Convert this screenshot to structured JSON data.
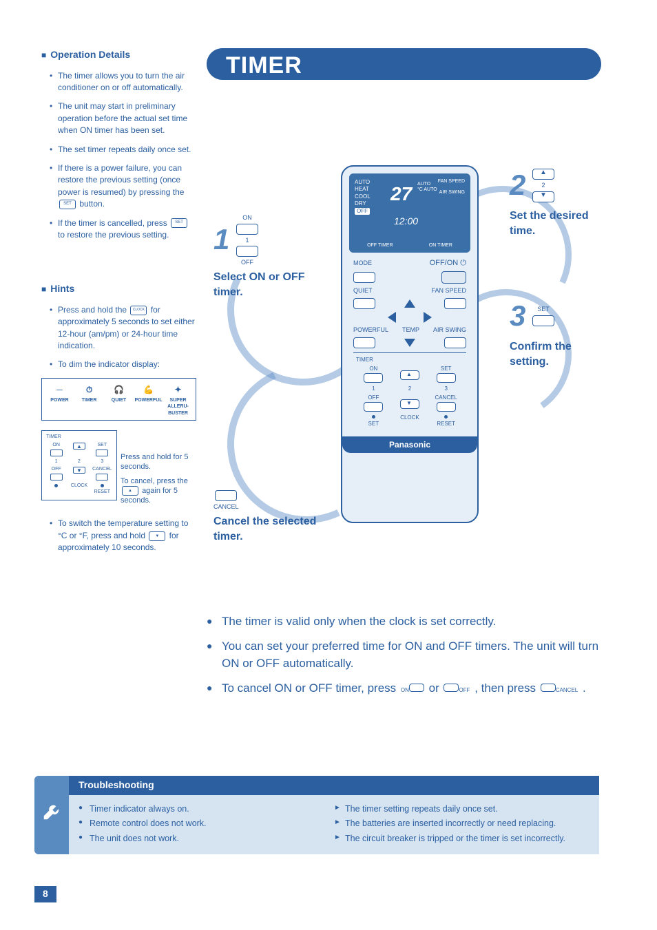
{
  "title": "TIMER",
  "page_number": "8",
  "left": {
    "op_details_head": "Operation Details",
    "op_details": [
      "The timer allows you to turn the air conditioner on or off automatically.",
      "The unit may start in preliminary operation before the actual set time when ON timer has been set.",
      "The set timer repeats daily once set.",
      "If there is a power failure, you can restore the previous setting (once power is resumed) by pressing the",
      "If the timer is cancelled, press"
    ],
    "op_btn_set": "SET",
    "op_prev_tail": " to restore the previous setting.",
    "op_four_tail": " button.",
    "hints_head": "Hints",
    "hints1_a": "Press and hold the ",
    "hints1_clock": "CLOCK",
    "hints1_b": " for approximately 5 seconds to set either 12-hour (am/pm) or 24-hour time indication.",
    "hints2": "To dim the indicator display:",
    "indicator": {
      "power": "POWER",
      "timer": "TIMER",
      "quiet": "QUIET",
      "powerful": "POWERFUL",
      "super": "SUPER ALLERU-BUSTER"
    },
    "mini_labels": {
      "timer": "TIMER",
      "on": "ON",
      "set": "SET",
      "one": "1",
      "two": "2",
      "three": "3",
      "off": "OFF",
      "cancel": "CANCEL",
      "clock": "CLOCK",
      "reset": "RESET"
    },
    "side_a": "Press and hold for 5 seconds.",
    "side_b": "To cancel, press the ",
    "side_c": " again for 5 seconds.",
    "hints3": "To switch the temperature setting to °C or °F, press and hold ",
    "hints3_b": " for approximately 10 seconds."
  },
  "steps": {
    "s1_num": "1",
    "s1_on": "ON",
    "s1_mid": "1",
    "s1_off": "OFF",
    "s1_txt": "Select ON or OFF timer.",
    "s2_num": "2",
    "s2_mid": "2",
    "s2_txt": "Set the desired time.",
    "s3_num": "3",
    "s3_set": "SET",
    "s3_txt": "Confirm the setting.",
    "sc_cancel": "CANCEL",
    "sc_txt": "Cancel the selected timer."
  },
  "remote": {
    "modes": [
      "AUTO",
      "HEAT",
      "COOL",
      "DRY",
      "OFF"
    ],
    "temp": "27",
    "unit_auto_top": "AUTO",
    "unit_auto": "AUTO",
    "unit_c": "°C",
    "fan": "FAN SPEED",
    "air": "AIR SWING",
    "clock": "12:00",
    "off_timer": "OFF TIMER",
    "on_timer": "ON TIMER",
    "mode": "MODE",
    "offon": "OFF/ON",
    "offon_icon": "⏻",
    "quiet": "QUIET",
    "fanspeed": "FAN SPEED",
    "powerful": "POWERFUL",
    "temp_l": "TEMP",
    "airswing": "AIR SWING",
    "tbox": {
      "title": "TIMER",
      "on": "ON",
      "set": "SET",
      "one": "1",
      "two": "2",
      "three": "3",
      "off": "OFF",
      "cancel": "CANCEL",
      "setb": "SET",
      "clock": "CLOCK",
      "reset": "RESET"
    },
    "brand": "Panasonic"
  },
  "notes": {
    "n1": "The timer is valid only when the clock is set correctly.",
    "n2": "You can set your preferred time for ON and OFF timers. The unit will turn ON or OFF automatically.",
    "n3_a": "To cancel ON or OFF timer, press ",
    "n3_or": " or ",
    "n3_b": ", then press ",
    "n3_on": "ON",
    "n3_off": "OFF",
    "n3_cancel": "CANCEL",
    "n3_c": "."
  },
  "trouble": {
    "head": "Troubleshooting",
    "left": [
      "Timer indicator always on.",
      "Remote control does not work.",
      "The unit does not work."
    ],
    "right": [
      "The timer setting repeats daily once set.",
      "The batteries are inserted incorrectly or need replacing.",
      "The circuit breaker is tripped or the timer is set incorrectly."
    ]
  }
}
